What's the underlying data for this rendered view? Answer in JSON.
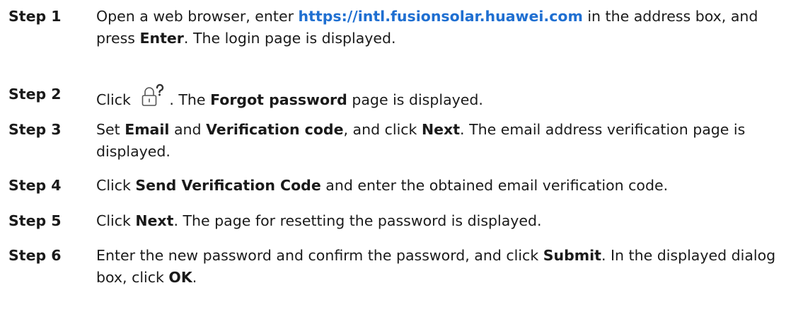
{
  "steps": [
    {
      "label": "Step 1",
      "parts": [
        {
          "t": "Open a web browser, enter ",
          "s": "normal"
        },
        {
          "t": "https://intl.fusionsolar.huawei.com",
          "s": "link"
        },
        {
          "t": " in the address box, and press ",
          "s": "normal"
        },
        {
          "t": "Enter",
          "s": "bold"
        },
        {
          "t": ". The login page is displayed.",
          "s": "normal"
        }
      ]
    },
    {
      "label": "Step 2",
      "parts": [
        {
          "t": "Click ",
          "s": "normal"
        },
        {
          "icon": "lock-question-icon"
        },
        {
          "t": ". The ",
          "s": "normal"
        },
        {
          "t": "Forgot password",
          "s": "bold"
        },
        {
          "t": " page is displayed.",
          "s": "normal"
        }
      ]
    },
    {
      "label": "Step 3",
      "parts": [
        {
          "t": "Set ",
          "s": "normal"
        },
        {
          "t": "Email",
          "s": "bold"
        },
        {
          "t": " and ",
          "s": "normal"
        },
        {
          "t": "Verification code",
          "s": "bold"
        },
        {
          "t": ", and click ",
          "s": "normal"
        },
        {
          "t": "Next",
          "s": "bold"
        },
        {
          "t": ". The email address verification page is displayed.",
          "s": "normal"
        }
      ]
    },
    {
      "label": "Step 4",
      "parts": [
        {
          "t": "Click ",
          "s": "normal"
        },
        {
          "t": "Send Verification Code",
          "s": "bold"
        },
        {
          "t": " and enter the obtained email verification code.",
          "s": "normal"
        }
      ]
    },
    {
      "label": "Step 5",
      "parts": [
        {
          "t": "Click ",
          "s": "normal"
        },
        {
          "t": "Next",
          "s": "bold"
        },
        {
          "t": ". The page for resetting the password is displayed.",
          "s": "normal"
        }
      ]
    },
    {
      "label": "Step 6",
      "parts": [
        {
          "t": "Enter the new password and confirm the password, and click ",
          "s": "normal"
        },
        {
          "t": "Submit",
          "s": "bold"
        },
        {
          "t": ". In the displayed dialog box, click ",
          "s": "normal"
        },
        {
          "t": "OK",
          "s": "bold"
        },
        {
          "t": ".",
          "s": "normal"
        }
      ]
    }
  ],
  "colors": {
    "text": "#1a1a1a",
    "link": "#1f6fd1",
    "icon": "#555555"
  }
}
